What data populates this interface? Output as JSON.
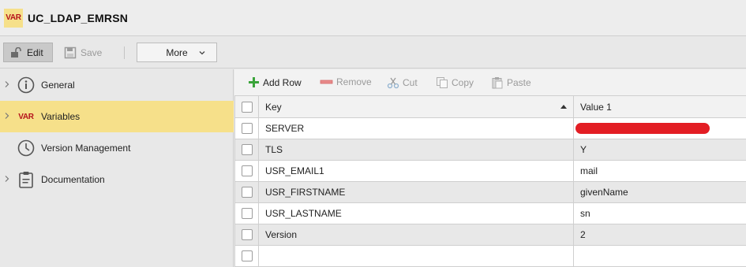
{
  "header": {
    "badge": "VAR",
    "title": "UC_LDAP_EMRSN"
  },
  "toolbar": {
    "edit_label": "Edit",
    "save_label": "Save",
    "more_label": "More"
  },
  "sidebar": {
    "items": [
      {
        "label": "General",
        "icon": "info-icon"
      },
      {
        "label": "Variables",
        "icon": "var-icon",
        "badge": "VAR"
      },
      {
        "label": "Version Management",
        "icon": "clock-icon"
      },
      {
        "label": "Documentation",
        "icon": "clipboard-icon"
      }
    ]
  },
  "grid_toolbar": {
    "add_row": "Add Row",
    "remove": "Remove",
    "cut": "Cut",
    "copy": "Copy",
    "paste": "Paste"
  },
  "table": {
    "columns": [
      "Key",
      "Value 1"
    ],
    "rows": [
      {
        "key": "SERVER",
        "value": ""
      },
      {
        "key": "TLS",
        "value": "Y"
      },
      {
        "key": "USR_EMAIL1",
        "value": "mail"
      },
      {
        "key": "USR_FIRSTNAME",
        "value": "givenName"
      },
      {
        "key": "USR_LASTNAME",
        "value": "sn"
      },
      {
        "key": "Version",
        "value": "2"
      },
      {
        "key": "",
        "value": ""
      }
    ]
  },
  "colors": {
    "accent_yellow": "#f6e08a",
    "brand_red": "#b5121b",
    "add_green": "#3aa43a",
    "redaction": "#e31e24"
  }
}
